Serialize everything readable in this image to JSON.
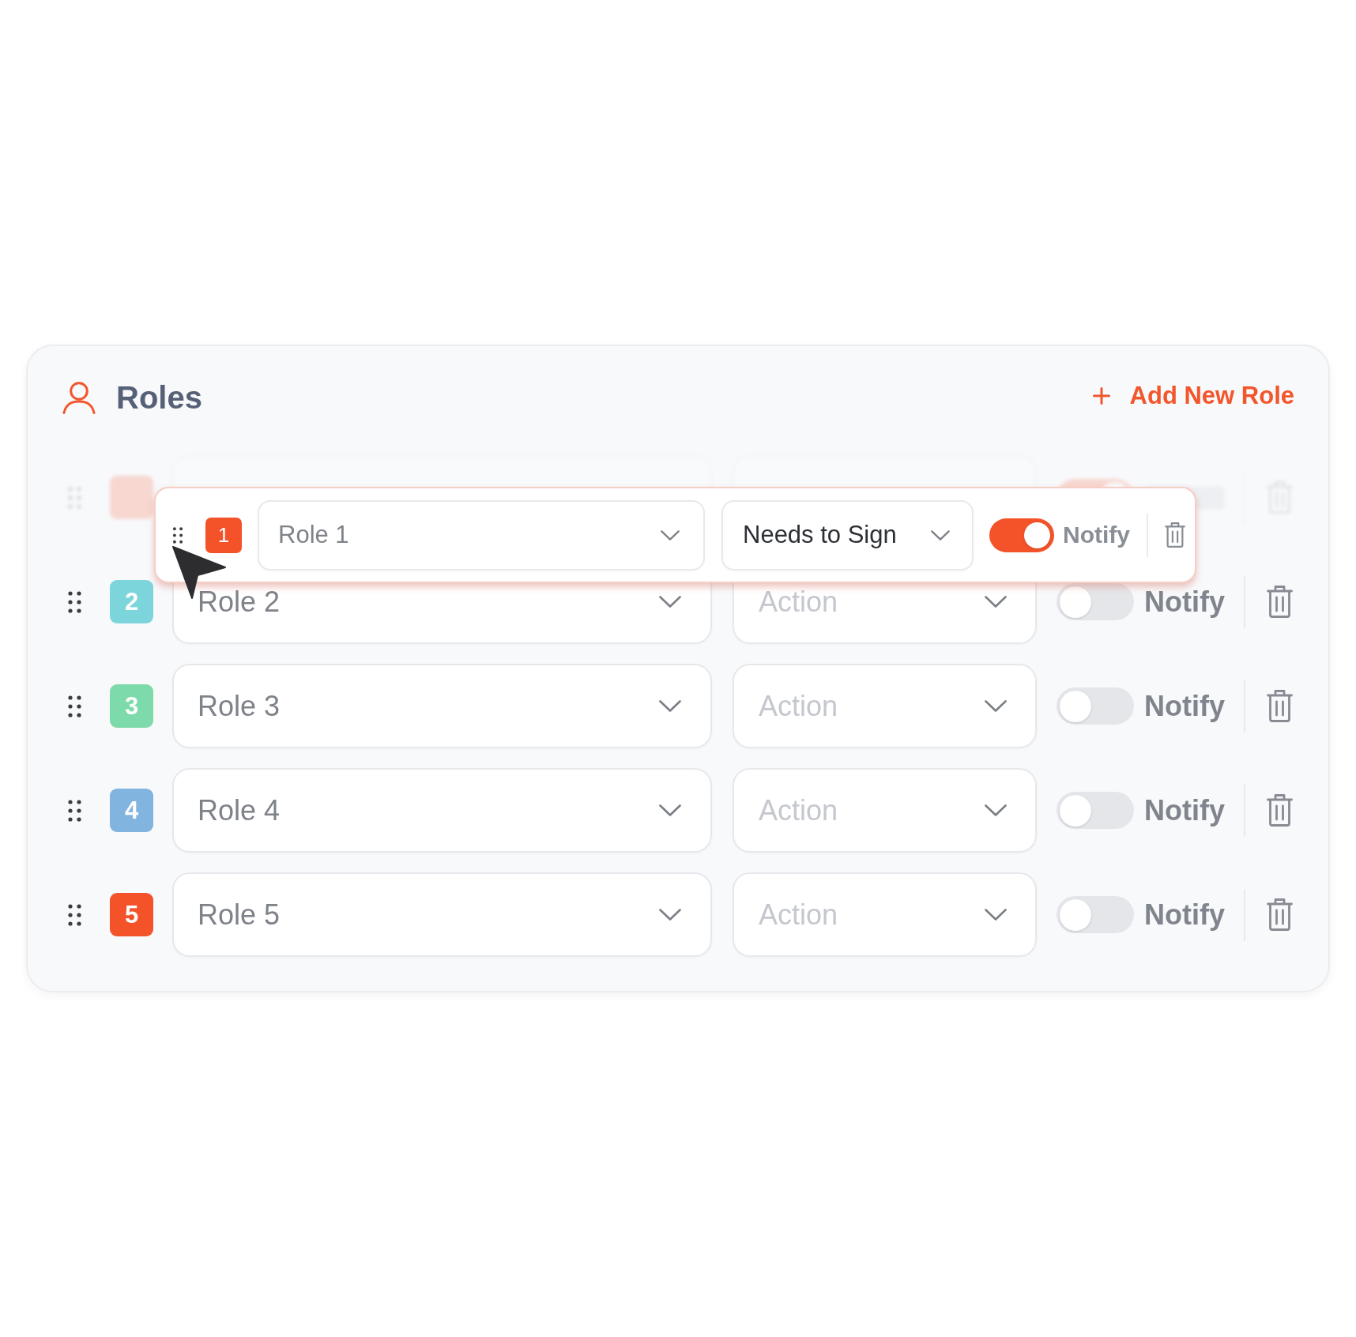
{
  "header": {
    "title": "Roles",
    "add_button": "Add New Role"
  },
  "roles": [
    {
      "badge": "1",
      "color": "#f4532a",
      "role": "Role 1",
      "action": {
        "value": "Needs to Sign"
      },
      "notify": true,
      "notify_label": "Notify",
      "dragging": true
    },
    {
      "badge": "2",
      "color": "#7dd5dc",
      "role": "Role 2",
      "action": {
        "placeholder": "Action"
      },
      "notify": false,
      "notify_label": "Notify",
      "dragging": false
    },
    {
      "badge": "3",
      "color": "#7ddaaa",
      "role": "Role 3",
      "action": {
        "placeholder": "Action"
      },
      "notify": false,
      "notify_label": "Notify",
      "dragging": false
    },
    {
      "badge": "4",
      "color": "#82b4e0",
      "role": "Role 4",
      "action": {
        "placeholder": "Action"
      },
      "notify": false,
      "notify_label": "Notify",
      "dragging": false
    },
    {
      "badge": "5",
      "color": "#f4532a",
      "role": "Role 5",
      "action": {
        "placeholder": "Action"
      },
      "notify": false,
      "notify_label": "Notify",
      "dragging": false
    }
  ]
}
